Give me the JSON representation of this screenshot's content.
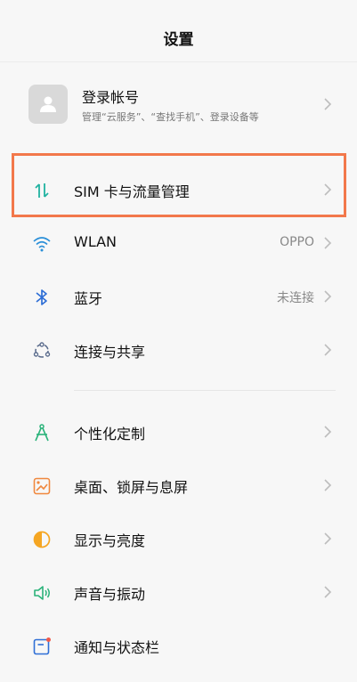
{
  "header": {
    "title": "设置"
  },
  "account": {
    "title": "登录帐号",
    "subtitle": "管理“云服务”、“查找手机”、登录设备等"
  },
  "menu": [
    {
      "label": "SIM 卡与流量管理",
      "value": "",
      "icon": "data-transfer-icon",
      "color": "#20b2a0",
      "highlighted": true
    },
    {
      "label": "WLAN",
      "value": "OPPO",
      "icon": "wifi-icon",
      "color": "#2a8fd8"
    },
    {
      "label": "蓝牙",
      "value": "未连接",
      "icon": "bluetooth-icon",
      "color": "#2f6fd6"
    },
    {
      "label": "连接与共享",
      "value": "",
      "icon": "share-connect-icon",
      "color": "#5a6b8c"
    },
    {
      "label": "个性化定制",
      "value": "",
      "icon": "compass-icon",
      "color": "#2bb37a"
    },
    {
      "label": "桌面、锁屏与息屏",
      "value": "",
      "icon": "wallpaper-icon",
      "color": "#f0883e"
    },
    {
      "label": "显示与亮度",
      "value": "",
      "icon": "brightness-icon",
      "color": "#f5a623"
    },
    {
      "label": "声音与振动",
      "value": "",
      "icon": "speaker-icon",
      "color": "#2bb37a"
    },
    {
      "label": "通知与状态栏",
      "value": "",
      "icon": "notification-icon",
      "color": "#2f6fd6"
    }
  ],
  "colors": {
    "highlight": "#f2784b",
    "background": "#f7f7f7"
  }
}
